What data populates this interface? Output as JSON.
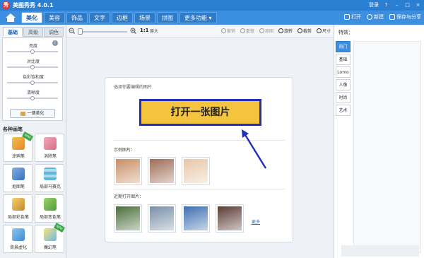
{
  "window": {
    "title": "美图秀秀 4.0.1",
    "login": "登录",
    "controls": [
      "?",
      "–",
      "□",
      "×"
    ]
  },
  "menu": {
    "tabs": [
      {
        "label": "美化",
        "active": true
      },
      {
        "label": "美容",
        "active": false
      },
      {
        "label": "饰品",
        "active": false
      },
      {
        "label": "文字",
        "active": false
      },
      {
        "label": "边框",
        "active": false
      },
      {
        "label": "场景",
        "active": false
      },
      {
        "label": "拼图",
        "active": false
      },
      {
        "label": "更多功能 ▾",
        "active": false
      }
    ],
    "actions": [
      "打开",
      "新建",
      "保存与分享"
    ]
  },
  "left": {
    "tabs": [
      "基础",
      "高级",
      "调色"
    ],
    "sliders": [
      {
        "label": "亮度",
        "value": 0.5
      },
      {
        "label": "对比度",
        "value": 0.5
      },
      {
        "label": "色彩饱和度",
        "value": 0.5
      },
      {
        "label": "清晰度",
        "value": 0.5
      }
    ],
    "one_click": "一键美化",
    "brush_title": "各种画笔",
    "brushes": [
      {
        "label": "涂鸦笔",
        "icon": "pencil-icon",
        "badge": "NEW"
      },
      {
        "label": "消除笔",
        "icon": "eraser-icon",
        "badge": ""
      },
      {
        "label": "抠图笔",
        "icon": "cutout-pen-icon",
        "badge": ""
      },
      {
        "label": "局部马赛克",
        "icon": "mosaic-icon",
        "badge": ""
      },
      {
        "label": "局部彩色笔",
        "icon": "color-brush-icon",
        "badge": ""
      },
      {
        "label": "局部变色笔",
        "icon": "recolor-brush-icon",
        "badge": ""
      },
      {
        "label": "背景虚化",
        "icon": "blur-background-icon",
        "badge": ""
      },
      {
        "label": "魔幻笔",
        "icon": "magic-pen-icon",
        "badge": "NEW"
      }
    ],
    "badge_text": "NEW"
  },
  "toolbar": {
    "zoom_ratio": "1:1",
    "zoom_orig": "原大",
    "tools": [
      {
        "label": "撤销",
        "enabled": false
      },
      {
        "label": "重做",
        "enabled": false
      },
      {
        "label": "原图",
        "enabled": false
      },
      {
        "label": "旋转",
        "enabled": true
      },
      {
        "label": "裁剪",
        "enabled": true
      },
      {
        "label": "尺寸",
        "enabled": true
      }
    ]
  },
  "canvas": {
    "hint": "选择你要编辑的图片",
    "open_button": "打开一张图片",
    "sample_title": "示例图片：",
    "recent_title": "近期打开图片：",
    "more": "更多",
    "arrow_color": "#1f2fb8",
    "samples": [
      "#c98e66",
      "#9e6c55",
      "#e8c6a8"
    ],
    "recent": [
      "#4b6e3a",
      "#7a8fa6",
      "#3d6fb0",
      "#5a3b35"
    ]
  },
  "right": {
    "title": "特效：",
    "categories": [
      {
        "label": "热门",
        "active": true
      },
      {
        "label": "基础",
        "active": false
      },
      {
        "label": "Lomo",
        "active": false
      },
      {
        "label": "人像",
        "active": false
      },
      {
        "label": "时尚",
        "active": false
      },
      {
        "label": "艺术",
        "active": false
      }
    ]
  }
}
